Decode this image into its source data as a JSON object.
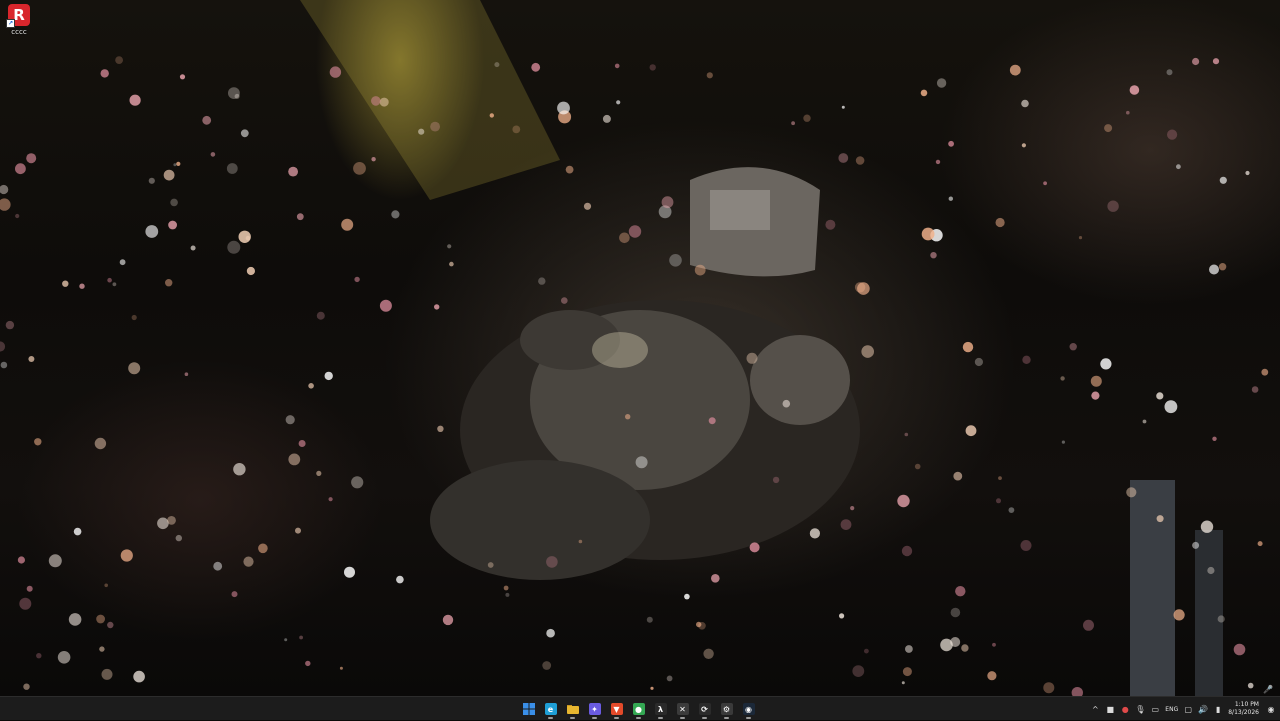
{
  "desktop": {
    "icons": [
      {
        "label": "cccc",
        "glyph": "R",
        "icon": "app-shortcut-icon",
        "color": "#d8262c"
      }
    ]
  },
  "taskbar": {
    "apps": [
      {
        "name": "start",
        "glyph": "",
        "icon": "windows-start-icon",
        "color": "#3a8fe8"
      },
      {
        "name": "edge",
        "glyph": "e",
        "icon": "edge-browser-icon",
        "color": "#1f9fd6"
      },
      {
        "name": "file-explorer",
        "glyph": "",
        "icon": "folder-icon",
        "color": "#e8b730"
      },
      {
        "name": "messenger",
        "glyph": "✦",
        "icon": "chat-app-icon",
        "color": "#6a5be0"
      },
      {
        "name": "brave",
        "glyph": "▼",
        "icon": "brave-browser-icon",
        "color": "#e34a2a"
      },
      {
        "name": "chrome",
        "glyph": "●",
        "icon": "chrome-browser-icon",
        "color": "#34a853"
      },
      {
        "name": "terminal",
        "glyph": "λ",
        "icon": "terminal-icon",
        "color": "#2a2a2a"
      },
      {
        "name": "xbox",
        "glyph": "✕",
        "icon": "xbox-icon",
        "color": "#3b3b3b"
      },
      {
        "name": "sync",
        "glyph": "⟳",
        "icon": "sync-app-icon",
        "color": "#2b2b2b"
      },
      {
        "name": "settings",
        "glyph": "⚙",
        "icon": "gear-icon",
        "color": "#3a3a3a"
      },
      {
        "name": "steam",
        "glyph": "◉",
        "icon": "steam-icon",
        "color": "#1b2838"
      }
    ],
    "tray": {
      "overflow": "^",
      "language": "ENG",
      "time": "1:10 PM",
      "date": "8/13/2026"
    }
  },
  "colors": {
    "taskbar_bg": "#1c1c1c",
    "accent": "#3a8fe8"
  }
}
